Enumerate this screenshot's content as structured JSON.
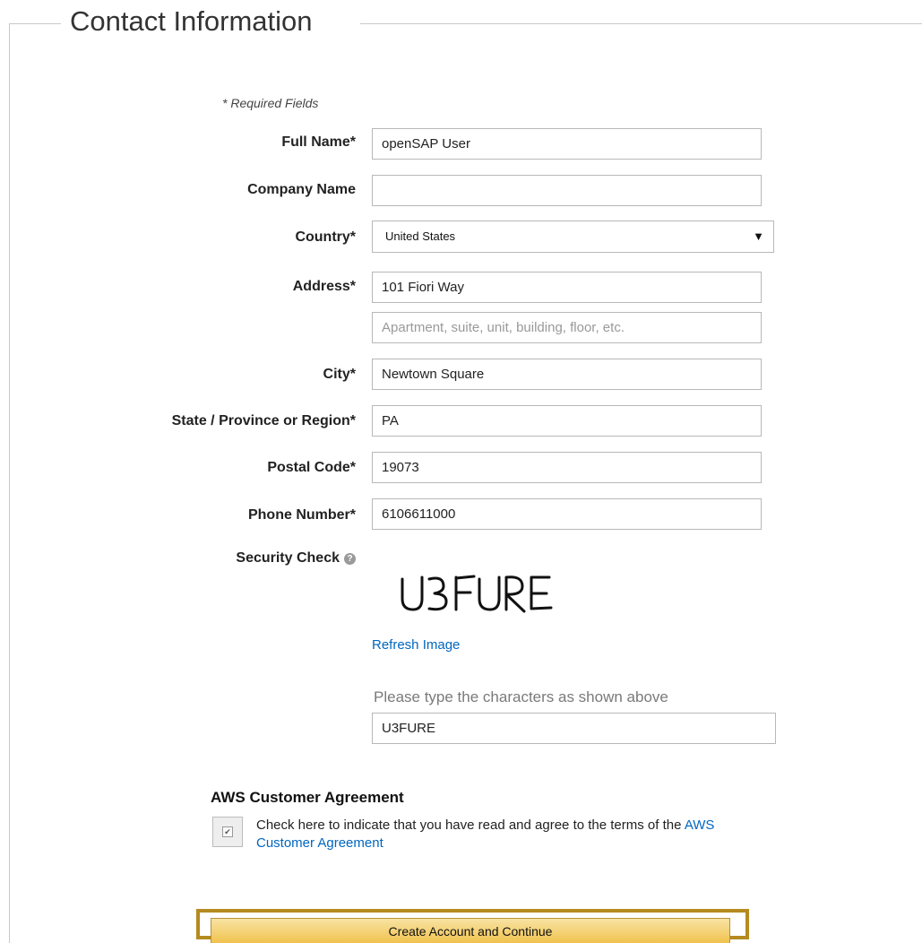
{
  "section_title": "Contact Information",
  "required_note": "* Required Fields",
  "form": {
    "full_name": {
      "label": "Full Name*",
      "value": "openSAP User"
    },
    "company_name": {
      "label": "Company Name",
      "value": ""
    },
    "country": {
      "label": "Country*",
      "value": "United States"
    },
    "address": {
      "label": "Address*",
      "line1_value": "101 Fiori Way",
      "line2_value": "",
      "line2_placeholder": "Apartment, suite, unit, building, floor, etc."
    },
    "city": {
      "label": "City*",
      "value": "Newtown Square"
    },
    "state": {
      "label": "State / Province or Region*",
      "value": "PA"
    },
    "postal_code": {
      "label": "Postal Code*",
      "value": "19073"
    },
    "phone": {
      "label": "Phone Number*",
      "value": "6106611000"
    }
  },
  "security": {
    "label": "Security Check",
    "help_icon": "question-circle-icon",
    "captcha_image_text": "U3FURE",
    "refresh_link": "Refresh Image",
    "prompt": "Please type the characters as shown above",
    "input_value": "U3FURE"
  },
  "agreement": {
    "title": "AWS Customer Agreement",
    "checked": true,
    "text": "Check here to indicate that you have read and agree to the terms of the ",
    "link_text": "AWS Customer Agreement"
  },
  "submit_button": "Create Account and Continue",
  "colors": {
    "link": "#0066c0",
    "button_top": "#f8e3a3",
    "button_bottom": "#f0c14b",
    "highlight": "#b58a1f"
  }
}
